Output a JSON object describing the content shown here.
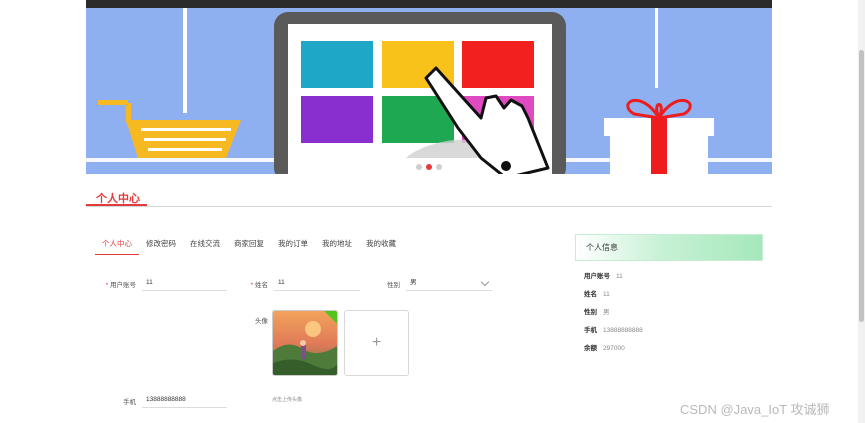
{
  "section": {
    "title": "个人中心"
  },
  "tabs": [
    {
      "label": "个人中心",
      "active": true
    },
    {
      "label": "修改密码",
      "active": false
    },
    {
      "label": "在线交流",
      "active": false
    },
    {
      "label": "商家回复",
      "active": false
    },
    {
      "label": "我的订单",
      "active": false
    },
    {
      "label": "我的地址",
      "active": false
    },
    {
      "label": "我的收藏",
      "active": false
    }
  ],
  "form": {
    "required_mark": "*",
    "account": {
      "label": "用户账号",
      "value": "11"
    },
    "name": {
      "label": "姓名",
      "value": "11"
    },
    "gender": {
      "label": "性别",
      "value": "男"
    },
    "avatar": {
      "label": "头像",
      "upload_tip": "点击上传头像",
      "upload_icon": "plus-icon"
    },
    "phone": {
      "label": "手机",
      "value": "13888888888"
    }
  },
  "info_card": {
    "title": "个人信息",
    "rows": [
      {
        "key": "用户账号",
        "value": "11"
      },
      {
        "key": "姓名",
        "value": "11"
      },
      {
        "key": "性别",
        "value": "男"
      },
      {
        "key": "手机",
        "value": "13888888888"
      },
      {
        "key": "余额",
        "value": "297000"
      }
    ]
  },
  "watermark": "CSDN @Java_IoT 攻诚狮",
  "colors": {
    "accent": "#e33b3b",
    "banner_bg": "#8fb0f0",
    "success": "#52c41a"
  }
}
